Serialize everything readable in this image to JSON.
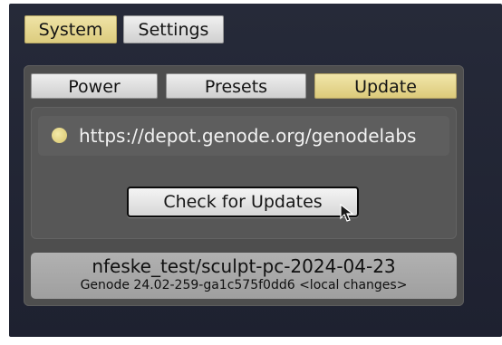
{
  "top_tabs": [
    {
      "label": "System",
      "active": true
    },
    {
      "label": "Settings",
      "active": false
    }
  ],
  "panel_tabs": [
    {
      "label": "Power",
      "active": false
    },
    {
      "label": "Presets",
      "active": false
    },
    {
      "label": "Update",
      "active": true
    }
  ],
  "depot": {
    "url": "https://depot.genode.org/genodelabs",
    "status_color": "#e6d98b"
  },
  "actions": {
    "check_label": "Check for Updates"
  },
  "version": {
    "image": "nfeske_test/sculpt-pc-2024-04-23",
    "build": "Genode 24.02-259-ga1c575f0dd6 <local changes>"
  },
  "colors": {
    "accent": "#e4d58f",
    "panel": "#4e4e4e",
    "background": "#1e2130"
  }
}
